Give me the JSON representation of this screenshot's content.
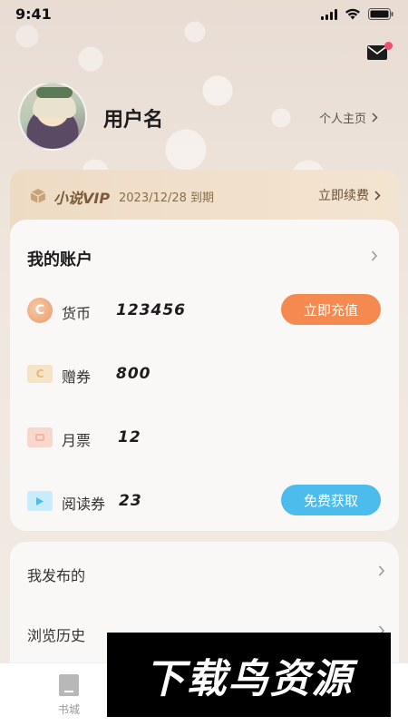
{
  "status_bar": {
    "time": "9:41"
  },
  "profile": {
    "username": "用户名",
    "homepage_link": "个人主页",
    "chevron": "›"
  },
  "vip": {
    "label": "小说VIP",
    "expiry": "2023/12/28 到期",
    "renew": "立即续费",
    "icon": "vip-box-icon"
  },
  "account": {
    "title": "我的账户",
    "rows": [
      {
        "label": "货币",
        "value": "123456",
        "icon_text": "C",
        "action": "立即充值"
      },
      {
        "label": "赠券",
        "value": "800",
        "icon_text": "C"
      },
      {
        "label": "月票",
        "value": "12"
      },
      {
        "label": "阅读券",
        "value": "23",
        "action": "免费获取"
      }
    ]
  },
  "menu": {
    "items": [
      "我发布的",
      "浏览历史"
    ]
  },
  "tabbar": {
    "tabs": [
      {
        "label": "书城",
        "icon": "book-icon"
      }
    ]
  },
  "watermark": {
    "text": "下载鸟资源"
  },
  "colors": {
    "accent_orange": "#f58a50",
    "accent_blue": "#4cbcec",
    "vip_gold": "#7a5b3a",
    "notification_red": "#f0506e"
  }
}
